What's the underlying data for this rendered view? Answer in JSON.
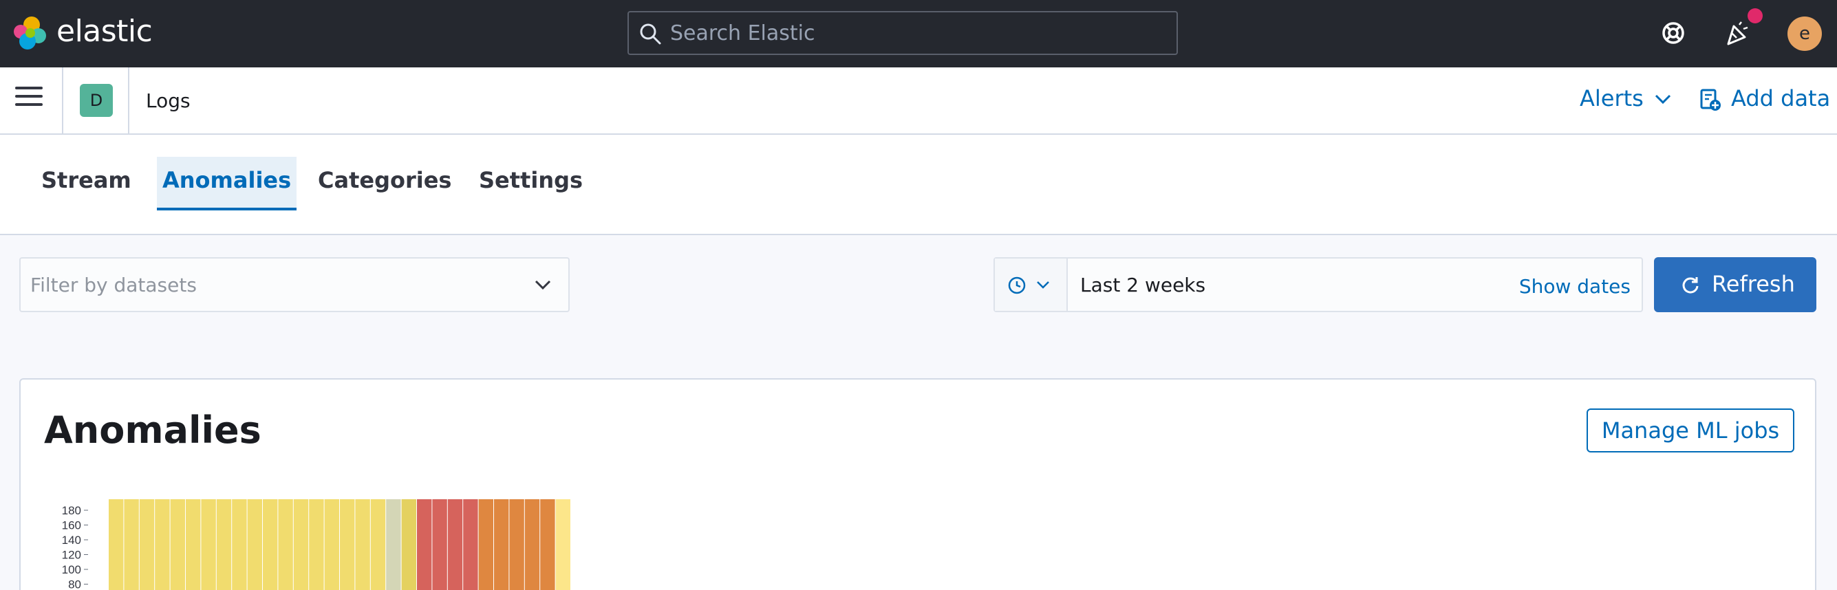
{
  "header": {
    "brand": "elastic",
    "search_placeholder": "Search Elastic",
    "avatar_initial": "e",
    "icons": [
      "elastic-logo-icon",
      "search-icon",
      "help-icon",
      "newsfeed-icon"
    ]
  },
  "breadcrumb_bar": {
    "space_initial": "D",
    "crumb": "Logs",
    "alerts_label": "Alerts",
    "add_data_label": "Add data"
  },
  "tabs": [
    {
      "label": "Stream",
      "active": false
    },
    {
      "label": "Anomalies",
      "active": true
    },
    {
      "label": "Categories",
      "active": false
    },
    {
      "label": "Settings",
      "active": false
    }
  ],
  "filters": {
    "datasets_placeholder": "Filter by datasets",
    "time_range": "Last 2 weeks",
    "show_dates": "Show dates",
    "refresh_label": "Refresh"
  },
  "panel": {
    "title": "Anomalies",
    "manage_button": "Manage ML jobs"
  },
  "chart_data": {
    "type": "bar",
    "y_ticks": [
      80,
      100,
      120,
      140,
      160,
      180
    ],
    "colors": {
      "low": "#f1dc6e",
      "low_light": "#e8d67a",
      "grey": "#d4d6b6",
      "mid": "#e4d160",
      "high": "#d6635c",
      "orange": "#df8740",
      "bright": "#fce68a"
    },
    "bars": [
      {
        "severity": "low"
      },
      {
        "severity": "low"
      },
      {
        "severity": "low"
      },
      {
        "severity": "low"
      },
      {
        "severity": "low"
      },
      {
        "severity": "low"
      },
      {
        "severity": "low"
      },
      {
        "severity": "low"
      },
      {
        "severity": "low"
      },
      {
        "severity": "low"
      },
      {
        "severity": "low"
      },
      {
        "severity": "low"
      },
      {
        "severity": "low"
      },
      {
        "severity": "low"
      },
      {
        "severity": "low"
      },
      {
        "severity": "low"
      },
      {
        "severity": "low"
      },
      {
        "severity": "low"
      },
      {
        "severity": "grey"
      },
      {
        "severity": "mid"
      },
      {
        "severity": "high"
      },
      {
        "severity": "high"
      },
      {
        "severity": "high"
      },
      {
        "severity": "high"
      },
      {
        "severity": "orange"
      },
      {
        "severity": "orange"
      },
      {
        "severity": "orange"
      },
      {
        "severity": "orange"
      },
      {
        "severity": "orange"
      },
      {
        "severity": "bright"
      }
    ]
  },
  "colors": {
    "header_bg": "#25282f",
    "accent": "#006bb8",
    "refresh_bg": "#2a6ebd",
    "space_badge": "#54b399",
    "avatar": "#e7a362",
    "news_dot": "#e0296a"
  }
}
